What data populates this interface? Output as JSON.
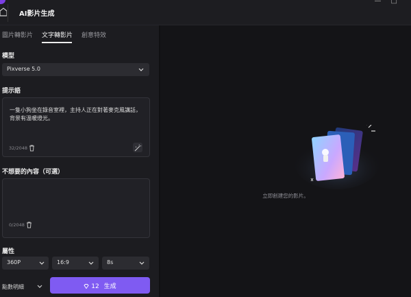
{
  "app": {
    "title": "AI影片生成"
  },
  "tabs": [
    {
      "label": "圖片轉影片"
    },
    {
      "label": "文字轉影片"
    },
    {
      "label": "創意特效"
    }
  ],
  "model": {
    "label": "模型",
    "value": "Pixverse 5.0"
  },
  "prompt": {
    "label": "提示語",
    "text": "一隻小狗坐在錄音室裡，主持人正在對著麥克風講話，背景有溫暖燈光。",
    "count": "32/2048"
  },
  "negative": {
    "label": "不想要的內容（可選）",
    "text": "",
    "count": "0/2048"
  },
  "settings": {
    "label": "屬性",
    "resolution": "360P",
    "ratio": "16:9",
    "duration": "8s"
  },
  "bottom": {
    "detail_label": "點數明細",
    "credits": "12",
    "generate_label": "生成"
  },
  "preview": {
    "empty_text": "立即創建您的影片。"
  },
  "colors": {
    "accent": "#7f5bf2",
    "background": "#1a1a1e"
  }
}
